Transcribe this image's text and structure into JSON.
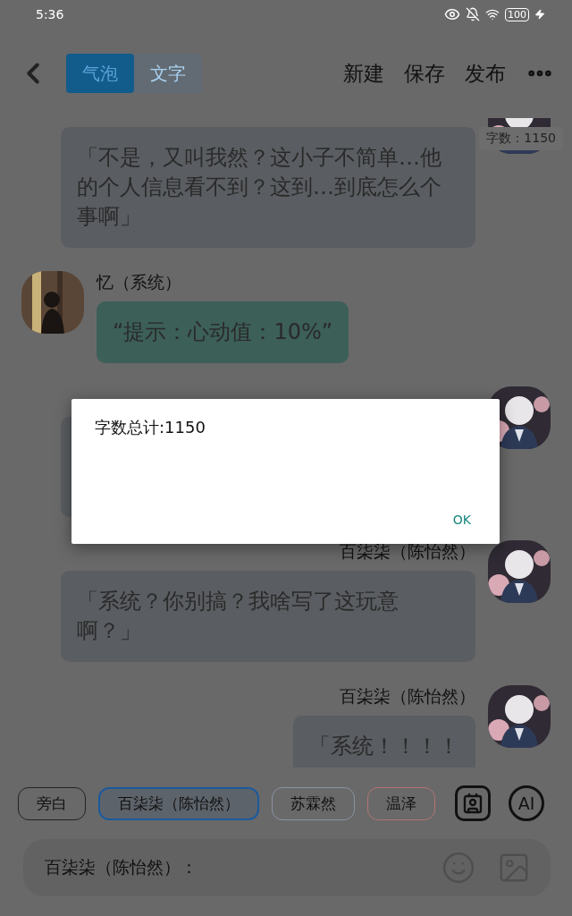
{
  "status_bar": {
    "time": "5:36",
    "battery": "100"
  },
  "header": {
    "tabs": [
      {
        "label": "气泡",
        "selected": true
      },
      {
        "label": "文字",
        "selected": false
      }
    ],
    "actions": [
      "新建",
      "保存",
      "发布"
    ]
  },
  "word_count": "字数：1150",
  "messages": [
    {
      "kind": "outgoing",
      "color": "#5a5d61",
      "text": "「不是，又叫我然？这小子不简单…他的个人信息看不到？这到…到底怎么个事啊」"
    },
    {
      "kind": "incoming",
      "name": "忆（系统）",
      "color": "#3c5f58",
      "text": "“提示：心动值：10%”"
    },
    {
      "kind": "covered",
      "color": "#5a5d61"
    },
    {
      "kind": "outgoing",
      "name": "百柒柒（陈怡然）",
      "color": "#5a5d61",
      "text": "「系统？你别搞？我啥写了这玩意啊？」"
    },
    {
      "kind": "outgoing",
      "name": "百柒柒（陈怡然）",
      "color": "#5a5d61",
      "text": "「系统！！！！"
    }
  ],
  "characters": [
    {
      "label": "旁白",
      "color": "#222222",
      "selected": false
    },
    {
      "label": "百柒柒（陈怡然）",
      "color": "#1c5a9c",
      "selected": true
    },
    {
      "label": "苏霖然",
      "color": "#8a93a3",
      "selected": false
    },
    {
      "label": "温泽",
      "color": "#b57474",
      "selected": false
    }
  ],
  "ai_button": "AI",
  "input": {
    "prefix": "百柒柒（陈怡然）："
  },
  "dialog": {
    "message": "字数总计:1150",
    "button": "OK"
  }
}
